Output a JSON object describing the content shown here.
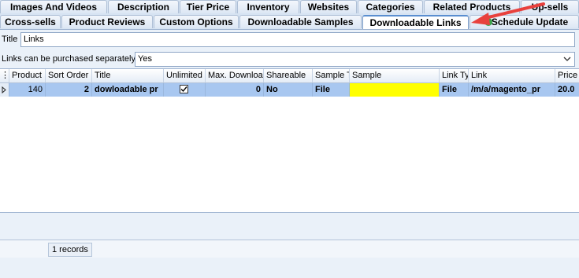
{
  "tabs_row1": [
    {
      "label": "Images And Videos",
      "active": false
    },
    {
      "label": "Description",
      "active": false
    },
    {
      "label": "Tier Price",
      "active": false
    },
    {
      "label": "Inventory",
      "active": false
    },
    {
      "label": "Websites",
      "active": false
    },
    {
      "label": "Categories",
      "active": false
    },
    {
      "label": "Related Products",
      "active": false
    },
    {
      "label": "Up-sells",
      "active": false
    }
  ],
  "tabs_row2": [
    {
      "label": "Cross-sells",
      "active": false
    },
    {
      "label": "Product Reviews",
      "active": false
    },
    {
      "label": "Custom Options",
      "active": false
    },
    {
      "label": "Downloadable Samples",
      "active": false
    },
    {
      "label": "Downloadable Links",
      "active": true
    },
    {
      "label": "Schedule Update",
      "active": false
    }
  ],
  "form": {
    "title_label": "Title",
    "title_value": "Links",
    "separate_label": "Links can be purchased separately",
    "separate_value": "Yes"
  },
  "toolbar": {
    "icons": [
      "add-icon",
      "edit-icon",
      "delete-icon",
      "fit-columns-icon",
      "grid-settings-icon"
    ]
  },
  "grid": {
    "columns": [
      "Product I",
      "Sort Order",
      "Title",
      "Unlimited",
      "Max. Downloads",
      "Shareable",
      "Sample T",
      "Sample",
      "Link Ty",
      "Link",
      "Price"
    ],
    "rows": [
      {
        "product_id": "140",
        "sort_order": "2",
        "title": "dowloadable pr",
        "unlimited": true,
        "max_downloads": "0",
        "shareable": "No",
        "sample_type": "File",
        "sample": "",
        "link_type": "File",
        "link": "/m/a/magento_pr",
        "price": "20.0"
      }
    ]
  },
  "footer": {
    "records": "1 records"
  },
  "colors": {
    "accent": "#5a8ed0",
    "row_selected": "#a8c7f0",
    "sample_highlight": "#ffff00",
    "arrow": "#e8413d"
  }
}
